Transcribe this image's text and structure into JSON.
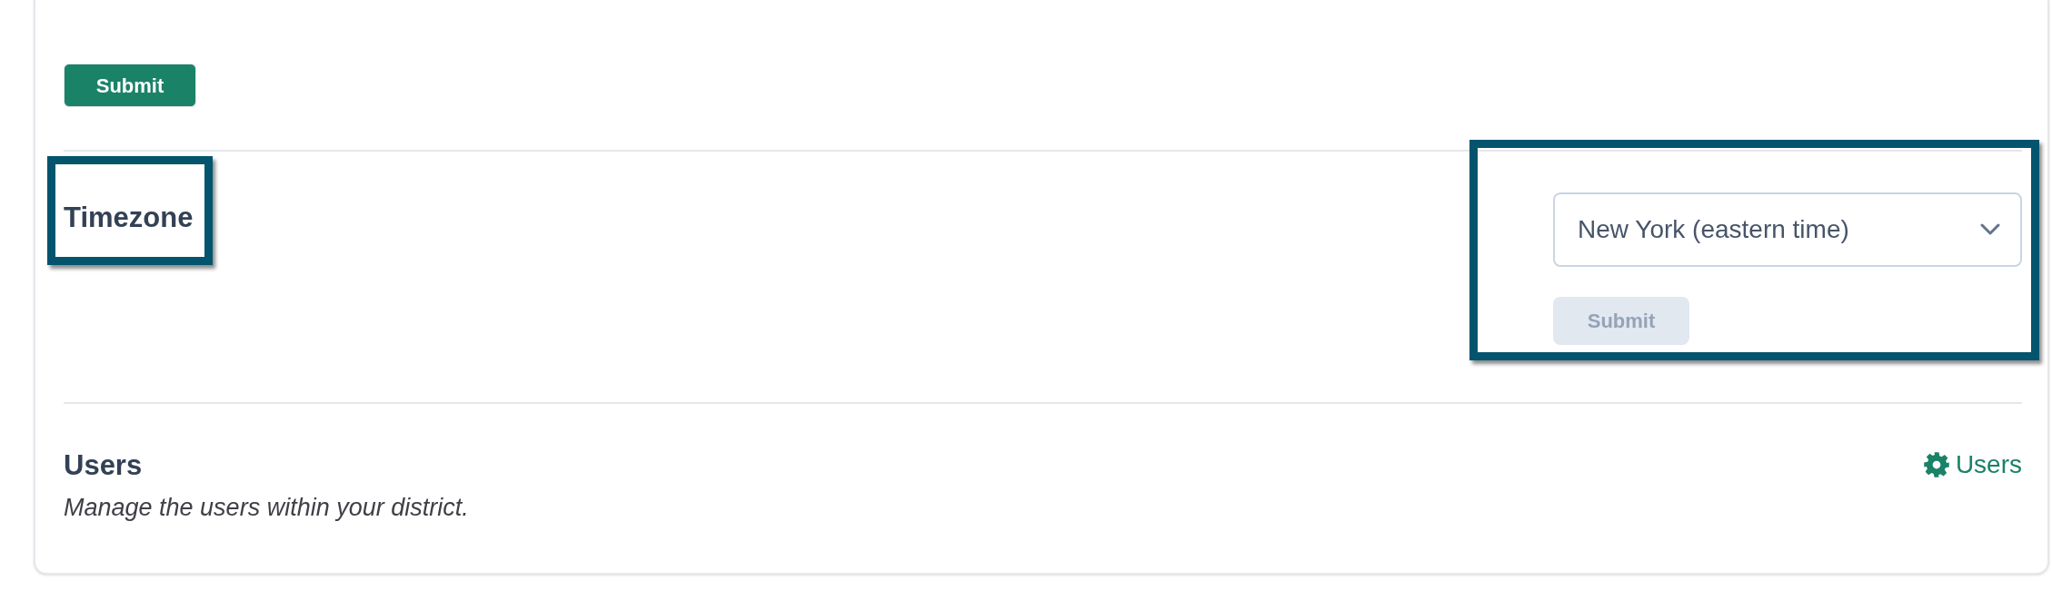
{
  "form_actions": {
    "submit": {
      "label": "Submit",
      "disabled": false
    }
  },
  "timezone": {
    "title": "Timezone",
    "title_highlighted": true,
    "select": {
      "value": "New York (eastern time)"
    },
    "submit": {
      "label": "Submit",
      "disabled": true
    },
    "controls_highlighted": true
  },
  "users": {
    "title": "Users",
    "description": "Manage the users within your district.",
    "link": {
      "label": "Users"
    }
  }
}
